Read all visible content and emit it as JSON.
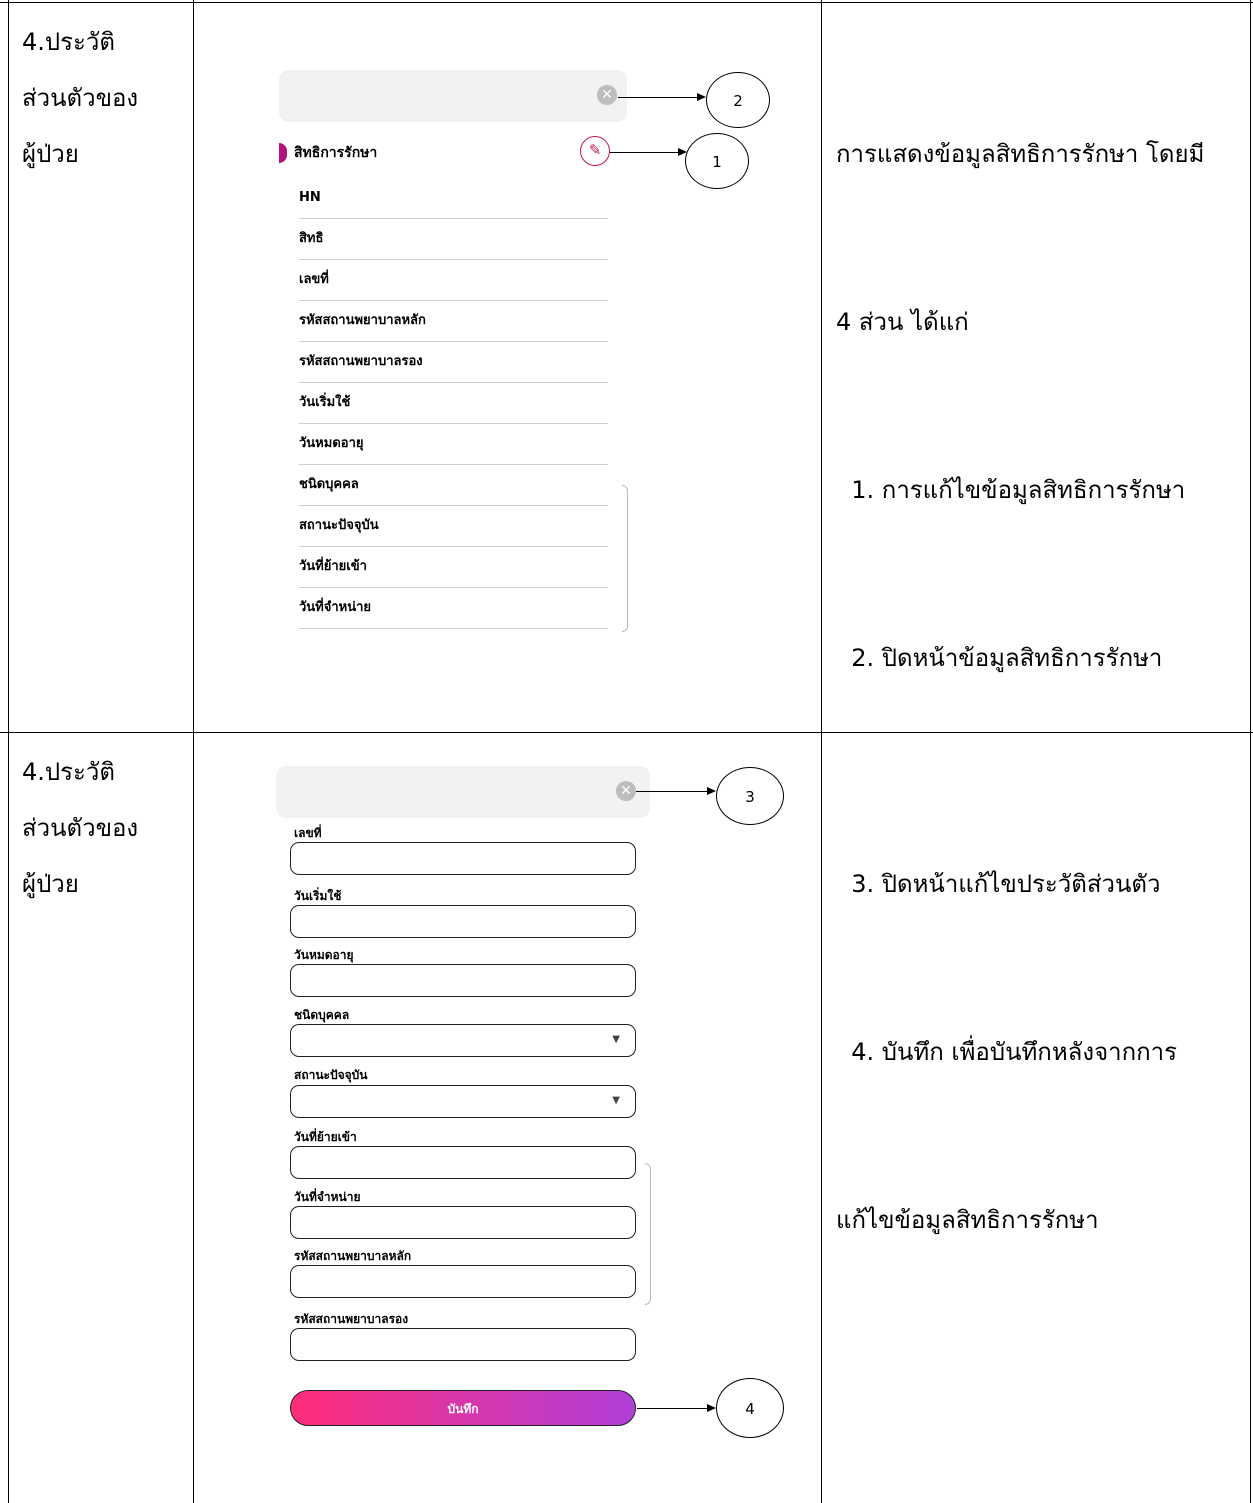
{
  "rows": [
    {
      "label_lines": [
        "4.ประวัติ",
        "ส่วนตัวของ",
        "ผู้ป่วย"
      ],
      "desc_lines": [
        "การแสดงข้อมูลสิทธิการรักษา โดยมี",
        "4 ส่วน ได้แก่",
        "  1. การแก้ไขข้อมูลสิทธิการรักษา",
        "  2. ปิดหน้าข้อมูลสิทธิการรักษา"
      ]
    },
    {
      "label_lines": [
        "4.ประวัติ",
        "ส่วนตัวของ",
        "ผู้ป่วย"
      ],
      "desc_lines": [
        "  3. ปิดหน้าแก้ไขประวัติส่วนตัว",
        "  4. บันทึก เพื่อบันทึกหลังจากการ",
        "แก้ไขข้อมูลสิทธิการรักษา"
      ]
    }
  ],
  "view_panel": {
    "section_title": "สิทธิการรักษา",
    "fields": [
      "HN",
      "สิทธิ",
      "เลขที่",
      "รหัสสถานพยาบาลหลัก",
      "รหัสสถานพยาบาลรอง",
      "วันเริ่มใช้",
      "วันหมดอายุ",
      "ชนิดบุคคล",
      "สถานะปัจจุบัน",
      "วันที่ย้ายเข้า",
      "วันที่จำหน่าย"
    ]
  },
  "edit_panel": {
    "fields": [
      {
        "label": "เลขที่",
        "value": ""
      },
      {
        "label": "วันเริ่มใช้",
        "value": ""
      },
      {
        "label": "วันหมดอายุ",
        "value": ""
      },
      {
        "label": "ชนิดบุคคล",
        "value": ""
      },
      {
        "label": "สถานะปัจจุบัน",
        "value": ""
      },
      {
        "label": "วันที่ย้ายเข้า",
        "value": ""
      },
      {
        "label": "วันที่จำหน่าย",
        "value": ""
      },
      {
        "label": "รหัสสถานพยาบาลหลัก",
        "value": ""
      },
      {
        "label": "รหัสสถานพยาบาลรอง",
        "value": ""
      }
    ],
    "save_label": "บันทึก"
  },
  "callouts": [
    "1",
    "2",
    "3",
    "4"
  ],
  "icons": {
    "close": "close-circle-icon",
    "edit": "pencil-icon",
    "dropdown": "caret-down-icon"
  },
  "colors": {
    "accent": "#c2185b",
    "gradient_start": "#ff2d7a",
    "gradient_end": "#b13fd9"
  }
}
